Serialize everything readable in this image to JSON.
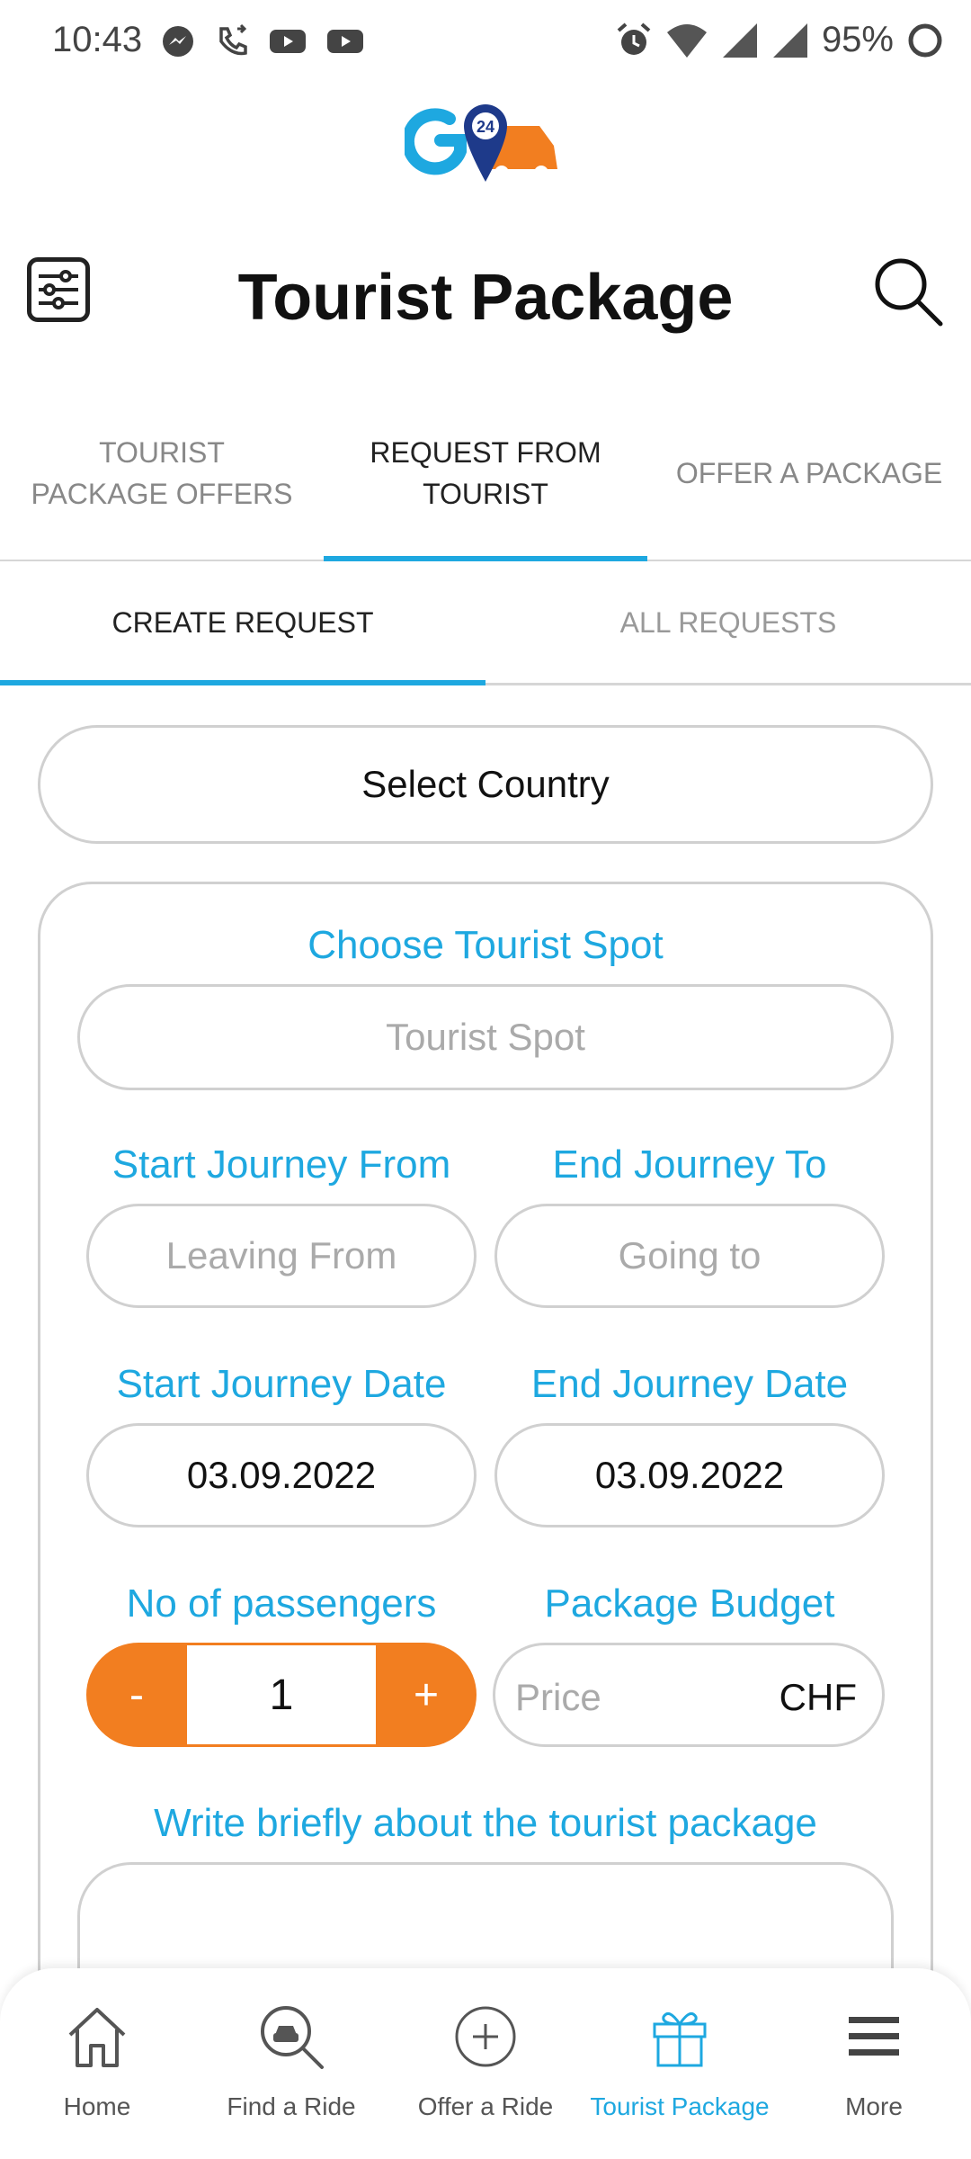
{
  "status_bar": {
    "time": "10:43",
    "battery_percent": "95%",
    "left_icons": [
      "messenger-icon",
      "phone-call-icon",
      "youtube-icon",
      "youtube-icon"
    ],
    "right_icons": [
      "alarm-icon",
      "wifi-icon",
      "signal-icon",
      "signal-icon",
      "battery-icon"
    ]
  },
  "header": {
    "title": "Tourist Package",
    "menu_icon": "sliders-icon",
    "search_icon": "search-icon"
  },
  "main_tabs": [
    {
      "label": "TOURIST PACKAGE OFFERS",
      "active": false
    },
    {
      "label": "REQUEST FROM TOURIST",
      "active": true
    },
    {
      "label": "OFFER A PACKAGE",
      "active": false
    }
  ],
  "sub_tabs": [
    {
      "label": "CREATE REQUEST",
      "active": true
    },
    {
      "label": "ALL REQUESTS",
      "active": false
    }
  ],
  "form": {
    "country_select": "Select Country",
    "tourist_spot_label": "Choose Tourist Spot",
    "tourist_spot_placeholder": "Tourist Spot",
    "start_from_label": "Start Journey From",
    "start_from_placeholder": "Leaving From",
    "end_to_label": "End Journey To",
    "end_to_placeholder": "Going to",
    "start_date_label": "Start Journey Date",
    "start_date_value": "03.09.2022",
    "end_date_label": "End Journey Date",
    "end_date_value": "03.09.2022",
    "passengers_label": "No of passengers",
    "passengers_minus": "-",
    "passengers_value": "1",
    "passengers_plus": "+",
    "budget_label": "Package Budget",
    "budget_placeholder": "Price",
    "budget_currency": "CHF",
    "description_label": "Write briefly about the tourist package"
  },
  "bottom_nav": [
    {
      "label": "Home",
      "icon": "home-icon",
      "active": false
    },
    {
      "label": "Find a Ride",
      "icon": "find-car-icon",
      "active": false
    },
    {
      "label": "Offer a Ride",
      "icon": "plus-circle-icon",
      "active": false
    },
    {
      "label": "Tourist Package",
      "icon": "gift-icon",
      "active": true
    },
    {
      "label": "More",
      "icon": "menu-icon",
      "active": false
    }
  ],
  "colors": {
    "accent_blue": "#1ea8e0",
    "accent_orange": "#f27e20",
    "border_gray": "#d0d0d0"
  }
}
